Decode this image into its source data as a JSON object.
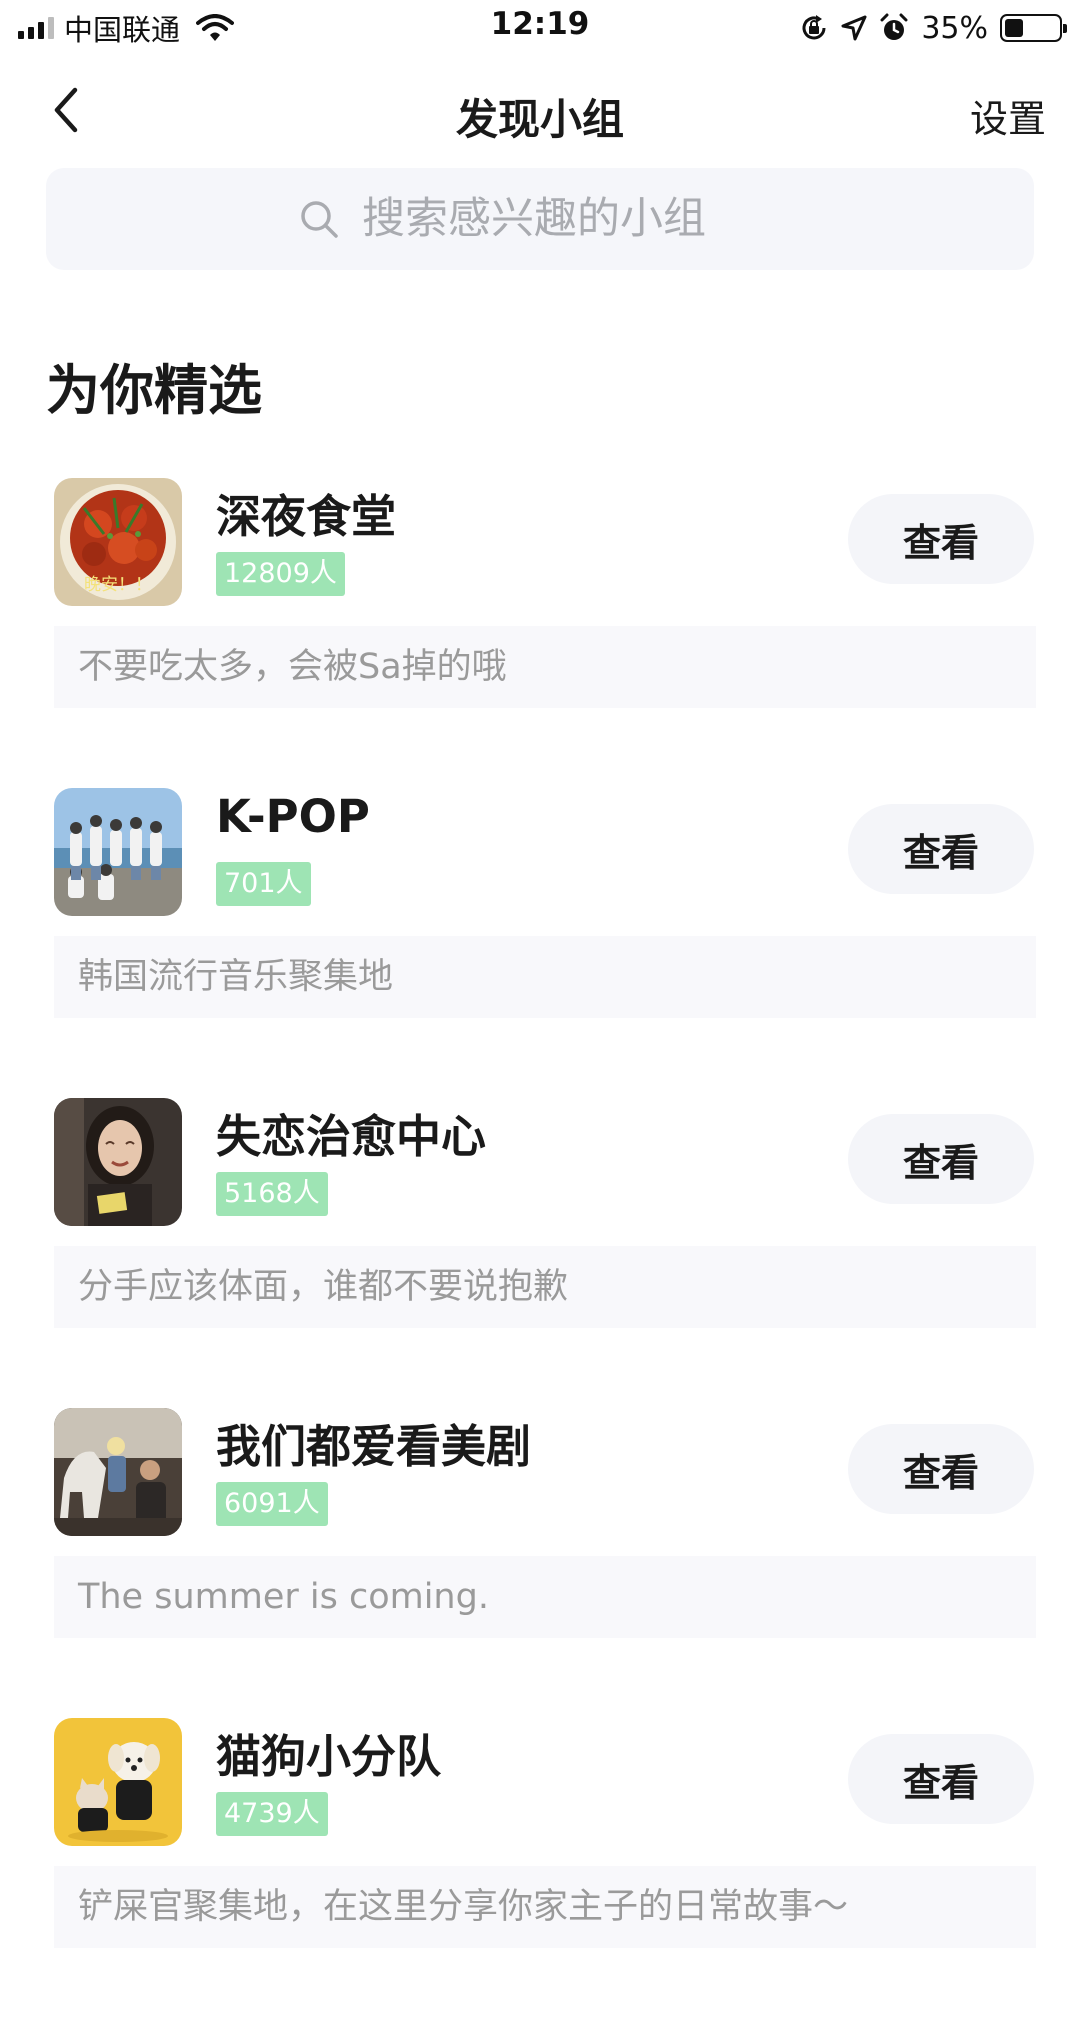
{
  "status_bar": {
    "carrier": "中国联通",
    "time": "12:19",
    "battery_percent": "35%",
    "battery_level": 0.35,
    "icons": [
      "signal-icon",
      "wifi-icon",
      "rotation-lock-icon",
      "location-arrow-icon",
      "alarm-icon",
      "battery-icon"
    ]
  },
  "nav": {
    "back_icon": "chevron-left-icon",
    "title": "发现小组",
    "settings_label": "设置"
  },
  "search": {
    "placeholder": "搜索感兴趣的小组",
    "value": "",
    "icon": "search-icon"
  },
  "section": {
    "title": "为你精选"
  },
  "groups": [
    {
      "name": "深夜食堂",
      "members": "12809人",
      "button": "查看",
      "description": "不要吃太多，会被Sa掉的哦",
      "avatar_caption": "晚安！！"
    },
    {
      "name": "K-POP",
      "members": "701人",
      "button": "查看",
      "description": "韩国流行音乐聚集地"
    },
    {
      "name": "失恋治愈中心",
      "members": "5168人",
      "button": "查看",
      "description": "分手应该体面，谁都不要说抱歉"
    },
    {
      "name": "我们都爱看美剧",
      "members": "6091人",
      "button": "查看",
      "description": "The summer is coming."
    },
    {
      "name": "猫狗小分队",
      "members": "4739人",
      "button": "查看",
      "description": "铲屎官聚集地，在这里分享你家主子的日常故事～"
    }
  ],
  "colors": {
    "badge_bg": "#9ee4b4",
    "button_bg": "#f4f5f9",
    "search_bg": "#f5f6fa",
    "desc_bg": "#f8f8fb",
    "desc_text": "#9a9a9a"
  }
}
